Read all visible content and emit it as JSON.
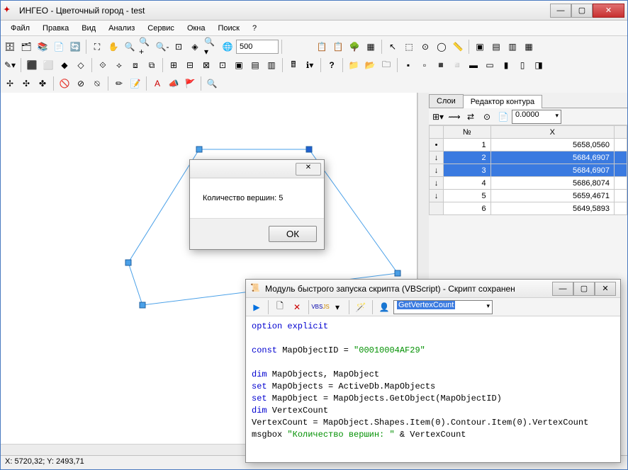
{
  "window": {
    "title": "ИНГЕО - Цветочный город - test"
  },
  "menu": {
    "items": [
      "Файл",
      "Правка",
      "Вид",
      "Анализ",
      "Сервис",
      "Окна",
      "Поиск"
    ]
  },
  "toolbar": {
    "zoom_value": "500"
  },
  "tabs": {
    "layers": "Слои",
    "contour_editor": "Редактор контура"
  },
  "contour_panel": {
    "combo_value": "0.0000",
    "columns": [
      "№",
      "X"
    ],
    "rows": [
      {
        "marker": "•",
        "n": "1",
        "x": "5658,0560",
        "sel": false
      },
      {
        "marker": "↓",
        "n": "2",
        "x": "5684,6907",
        "sel": true
      },
      {
        "marker": "↓",
        "n": "3",
        "x": "5684,6907",
        "sel": true
      },
      {
        "marker": "↓",
        "n": "4",
        "x": "5686,8074",
        "sel": false
      },
      {
        "marker": "↓",
        "n": "5",
        "x": "5659,4671",
        "sel": false
      },
      {
        "marker": " ",
        "n": "6",
        "x": "5649,5893",
        "sel": false
      }
    ]
  },
  "msgbox": {
    "text": "Количество вершин: 5",
    "ok": "ОК"
  },
  "script_window": {
    "title": "Модуль быстрого запуска скрипта (VBScript) - Скрипт сохранен",
    "combo": "GetVertexCount",
    "code_lines": [
      {
        "t": "kw",
        "s": "option explicit"
      },
      {
        "t": "",
        "s": ""
      },
      {
        "t": "mix",
        "s": "const MapObjectID = \"00010004AF29\""
      },
      {
        "t": "",
        "s": ""
      },
      {
        "t": "kw",
        "s": "dim MapObjects, MapObject"
      },
      {
        "t": "mix2",
        "s": "set MapObjects = ActiveDb.MapObjects"
      },
      {
        "t": "mix2",
        "s": "set MapObject = MapObjects.GetObject(MapObjectID)"
      },
      {
        "t": "kw",
        "s": "dim VertexCount"
      },
      {
        "t": "id",
        "s": "VertexCount = MapObject.Shapes.Item(0).Contour.Item(0).VertexCount"
      },
      {
        "t": "mix3",
        "s": "msgbox \"Количество вершин: \" & VertexCount"
      }
    ]
  },
  "statusbar": {
    "coords": "X: 5720,32; Y: 2493,71"
  }
}
